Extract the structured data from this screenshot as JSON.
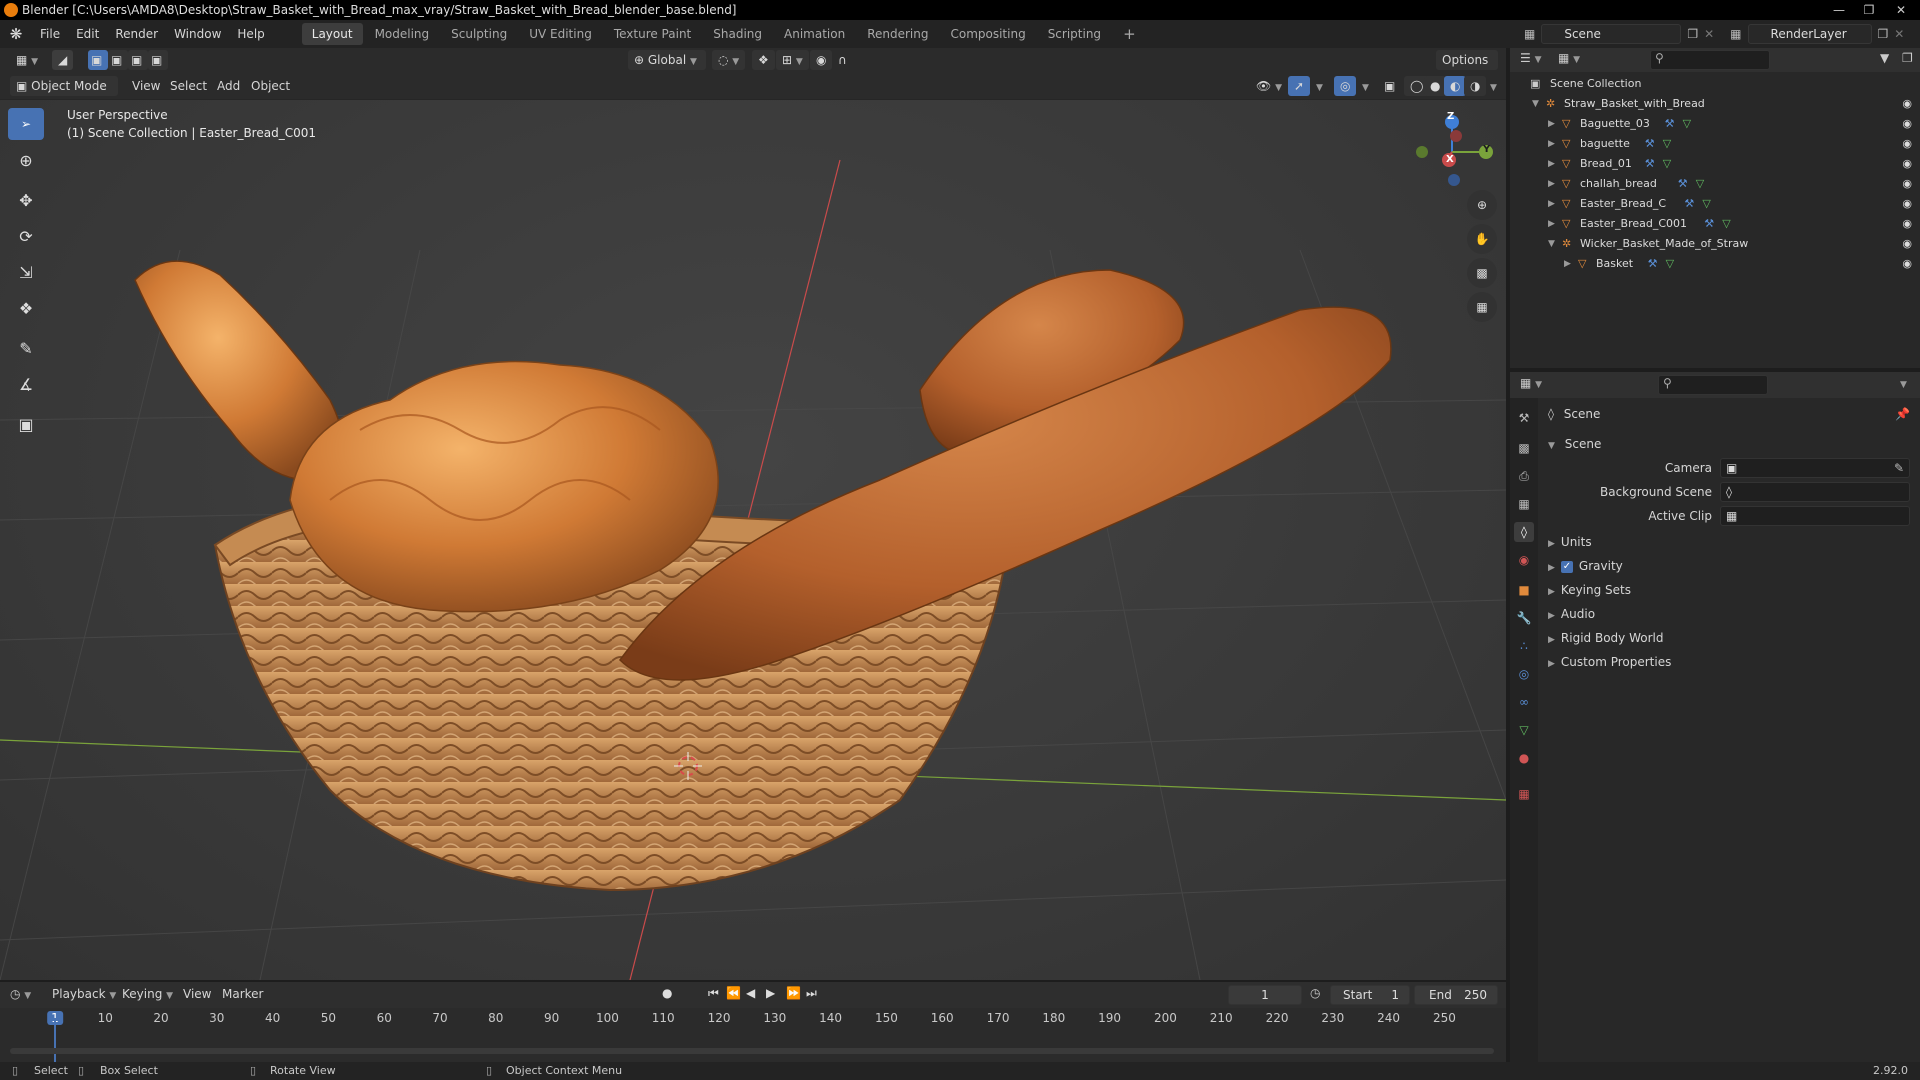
{
  "window": {
    "title": "Blender [C:\\Users\\AMDA8\\Desktop\\Straw_Basket_with_Bread_max_vray/Straw_Basket_with_Bread_blender_base.blend]"
  },
  "menu": [
    "File",
    "Edit",
    "Render",
    "Window",
    "Help"
  ],
  "workspaces": [
    "Layout",
    "Modeling",
    "Sculpting",
    "UV Editing",
    "Texture Paint",
    "Shading",
    "Animation",
    "Rendering",
    "Compositing",
    "Scripting"
  ],
  "active_workspace": "Layout",
  "scene_field": "Scene",
  "renderlayer_field": "RenderLayer",
  "vp_toolbar": {
    "orientation": "Global",
    "options": "Options"
  },
  "vp_header": {
    "mode": "Object Mode",
    "menus": [
      "View",
      "Select",
      "Add",
      "Object"
    ]
  },
  "viewport": {
    "perspective": "User Perspective",
    "collection_info": "(1) Scene Collection | Easter_Bread_C001",
    "axes": {
      "x": "X",
      "y": "Y",
      "z": "Z"
    }
  },
  "outliner": {
    "root": "Scene Collection",
    "items": [
      {
        "name": "Straw_Basket_with_Bread",
        "depth": 1,
        "type": "empty"
      },
      {
        "name": "Baguette_03",
        "depth": 2,
        "type": "mesh"
      },
      {
        "name": "baguette",
        "depth": 2,
        "type": "mesh"
      },
      {
        "name": "Bread_01",
        "depth": 2,
        "type": "mesh"
      },
      {
        "name": "challah_bread",
        "depth": 2,
        "type": "mesh"
      },
      {
        "name": "Easter_Bread_C",
        "depth": 2,
        "type": "mesh"
      },
      {
        "name": "Easter_Bread_C001",
        "depth": 2,
        "type": "mesh"
      },
      {
        "name": "Wicker_Basket_Made_of_Straw",
        "depth": 2,
        "type": "empty"
      },
      {
        "name": "Basket",
        "depth": 3,
        "type": "mesh"
      }
    ]
  },
  "properties": {
    "context": "Scene",
    "panel": "Scene",
    "fields": [
      {
        "label": "Camera"
      },
      {
        "label": "Background Scene"
      },
      {
        "label": "Active Clip"
      }
    ],
    "subpanels": [
      "Units",
      "Gravity",
      "Keying Sets",
      "Audio",
      "Rigid Body World",
      "Custom Properties"
    ],
    "gravity_checked": true
  },
  "timeline": {
    "menus": [
      "Playback",
      "Keying",
      "View",
      "Marker"
    ],
    "current_frame": "1",
    "start_label": "Start",
    "start": "1",
    "end_label": "End",
    "end": "250",
    "ruler": [
      "1",
      "10",
      "20",
      "30",
      "40",
      "50",
      "60",
      "70",
      "80",
      "90",
      "100",
      "110",
      "120",
      "130",
      "140",
      "150",
      "160",
      "170",
      "180",
      "190",
      "200",
      "210",
      "220",
      "230",
      "240",
      "250"
    ]
  },
  "status": {
    "select": "Select",
    "box_select": "Box Select",
    "rotate_view": "Rotate View",
    "context_menu": "Object Context Menu",
    "version": "2.92.0"
  },
  "colors": {
    "accent": "#4772b3",
    "x_axis": "#c94b4b",
    "y_axis": "#7aa33b",
    "z_axis": "#3f7fd6",
    "mesh_icon": "#e08a3c",
    "data_icon": "#60b860"
  }
}
